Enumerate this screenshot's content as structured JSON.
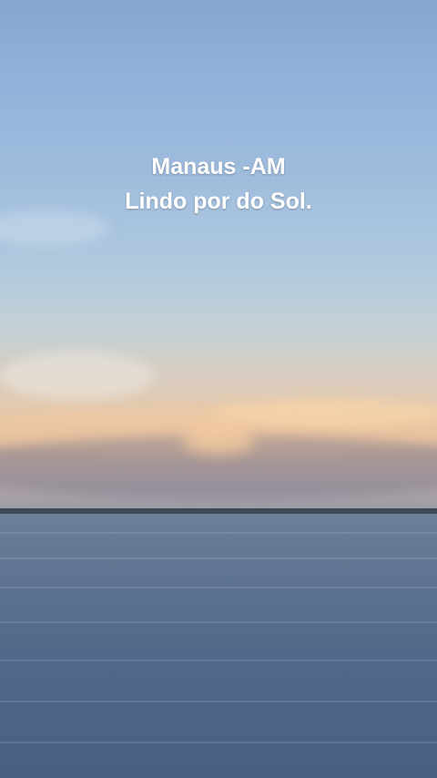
{
  "caption": {
    "line1": "Manaus -AM",
    "line2": "Lindo por do Sol."
  },
  "colors": {
    "sky_top": "#87a6cf",
    "sunset_band": "#e8c7a6",
    "water": "#51688a",
    "caption_text": "#ffffff"
  }
}
